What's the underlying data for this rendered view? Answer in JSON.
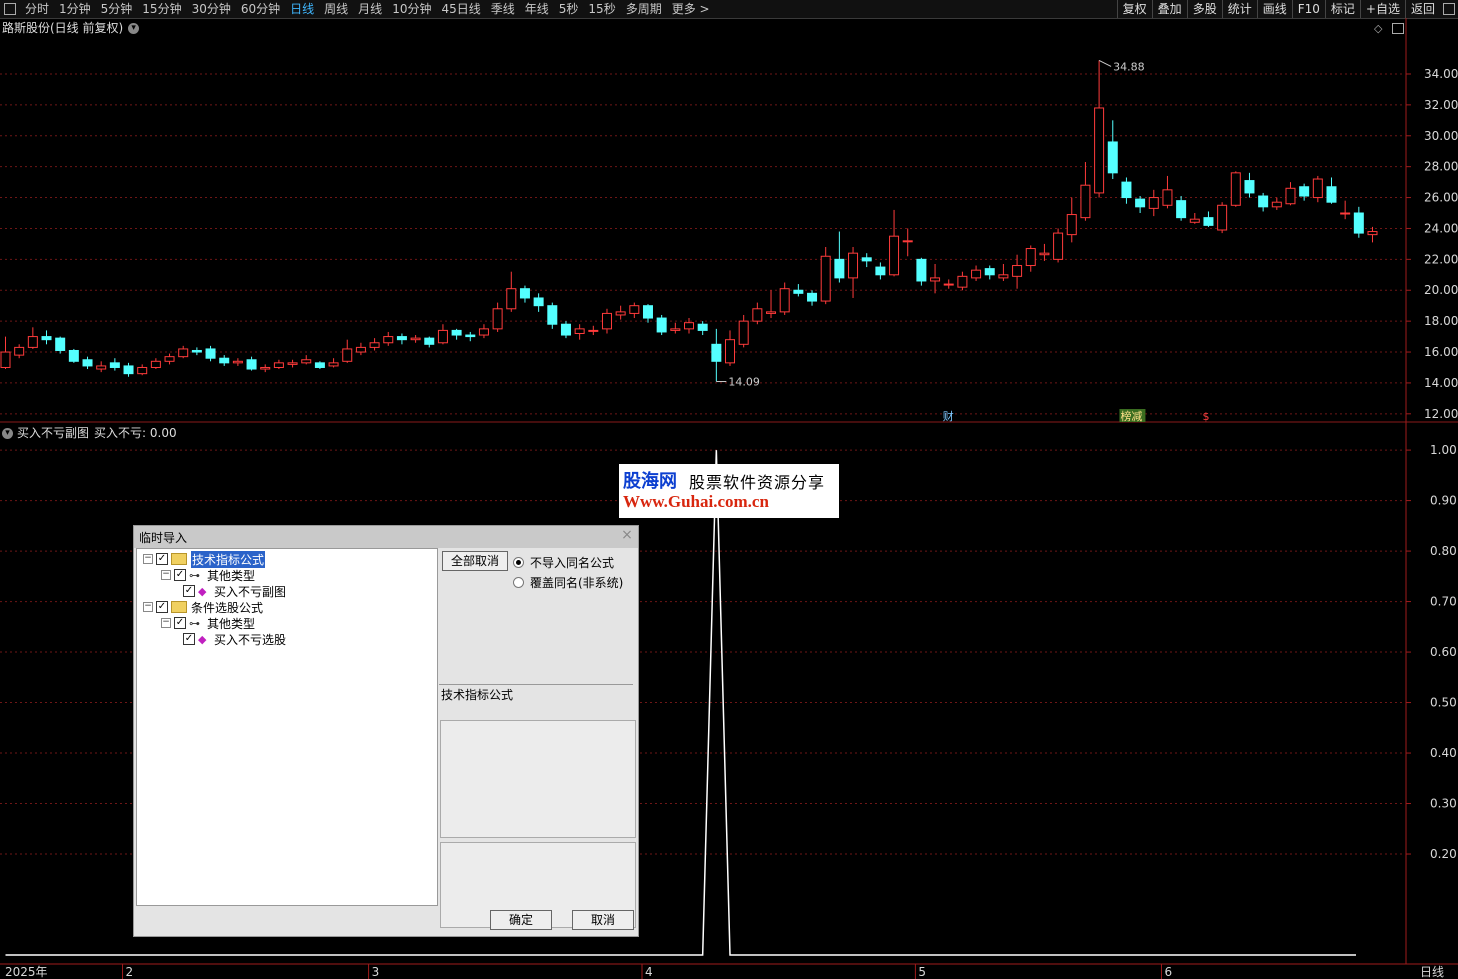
{
  "topbar": {
    "periods": [
      "分时",
      "1分钟",
      "5分钟",
      "15分钟",
      "30分钟",
      "60分钟",
      "日线",
      "周线",
      "月线",
      "10分钟",
      "45日线",
      "季线",
      "年线",
      "5秒",
      "15秒",
      "多周期",
      "更多 >"
    ],
    "active_period": "日线",
    "right_buttons": [
      "复权",
      "叠加",
      "多股",
      "统计",
      "画线",
      "F10",
      "标记",
      "+自选",
      "返回"
    ]
  },
  "main_chart": {
    "title": "路斯股份(日线 前复权)"
  },
  "sub_chart": {
    "title": "买入不亏副图",
    "value_label": "买入不亏: 0.00"
  },
  "watermark": {
    "brand": "股海网",
    "tagline": "股票软件资源分享",
    "url": "Www.Guhai.com.cn"
  },
  "dialog": {
    "title": "临时导入",
    "tree": [
      {
        "label": "技术指标公式",
        "level": 0,
        "selected": true
      },
      {
        "label": "其他类型",
        "level": 1
      },
      {
        "label": "买入不亏副图",
        "level": 2
      },
      {
        "label": "条件选股公式",
        "level": 0
      },
      {
        "label": "其他类型",
        "level": 1
      },
      {
        "label": "买入不亏选股",
        "level": 2
      }
    ],
    "cancel_all": "全部取消",
    "radio_no_import": "不导入同名公式",
    "radio_overwrite": "覆盖同名(非系统)",
    "group_label": "技术指标公式",
    "ok": "确定",
    "cancel": "取消"
  },
  "chart_data": [
    {
      "type": "candlestick",
      "title": "路斯股份(日线 前复权)",
      "y_ticks": [
        "34.00",
        "32.00",
        "30.00",
        "28.00",
        "26.00",
        "24.00",
        "22.00",
        "20.00",
        "18.00",
        "16.00",
        "14.00",
        "12.00"
      ],
      "ylim": [
        11.6,
        36.2
      ],
      "annotations": {
        "high": "34.88",
        "low": "14.09"
      },
      "markers": [
        "财",
        "榜减",
        "$"
      ],
      "x_labels": [
        "2025年",
        "2",
        "3",
        "4",
        "5",
        "6"
      ],
      "x_label_days": [
        0,
        9,
        27,
        47,
        67,
        85
      ],
      "up_color": "#ff3b3b",
      "down_color": "#54ffff",
      "candles": [
        [
          15.0,
          16.0,
          17.0,
          14.9
        ],
        [
          15.8,
          16.3,
          16.5,
          15.6
        ],
        [
          16.3,
          17.0,
          17.6,
          16.2
        ],
        [
          17.0,
          16.8,
          17.4,
          16.5
        ],
        [
          16.9,
          16.1,
          17.0,
          15.9
        ],
        [
          16.1,
          15.4,
          16.2,
          15.3
        ],
        [
          15.5,
          15.1,
          15.7,
          14.9
        ],
        [
          14.9,
          15.1,
          15.4,
          14.7
        ],
        [
          15.3,
          15.0,
          15.6,
          14.8
        ],
        [
          15.1,
          14.6,
          15.3,
          14.4
        ],
        [
          14.6,
          15.0,
          15.2,
          14.5
        ],
        [
          15.0,
          15.4,
          15.6,
          14.9
        ],
        [
          15.4,
          15.7,
          15.9,
          15.2
        ],
        [
          15.7,
          16.2,
          16.4,
          15.6
        ],
        [
          16.1,
          16.0,
          16.3,
          15.8
        ],
        [
          16.2,
          15.6,
          16.4,
          15.4
        ],
        [
          15.6,
          15.3,
          15.8,
          15.1
        ],
        [
          15.3,
          15.4,
          15.6,
          15.1
        ],
        [
          15.5,
          14.9,
          15.7,
          14.8
        ],
        [
          14.9,
          15.0,
          15.2,
          14.7
        ],
        [
          15.0,
          15.3,
          15.5,
          14.9
        ],
        [
          15.2,
          15.3,
          15.5,
          15.0
        ],
        [
          15.3,
          15.5,
          15.8,
          15.2
        ],
        [
          15.3,
          15.0,
          15.4,
          14.9
        ],
        [
          15.1,
          15.3,
          15.6,
          15.0
        ],
        [
          15.4,
          16.2,
          16.8,
          15.3
        ],
        [
          16.0,
          16.3,
          16.6,
          15.8
        ],
        [
          16.3,
          16.6,
          16.9,
          16.1
        ],
        [
          16.6,
          17.0,
          17.3,
          16.4
        ],
        [
          17.0,
          16.8,
          17.2,
          16.5
        ],
        [
          16.8,
          16.9,
          17.1,
          16.6
        ],
        [
          16.9,
          16.5,
          17.0,
          16.3
        ],
        [
          16.6,
          17.4,
          17.8,
          16.5
        ],
        [
          17.4,
          17.1,
          17.5,
          16.8
        ],
        [
          17.1,
          17.0,
          17.3,
          16.7
        ],
        [
          17.1,
          17.5,
          17.8,
          16.9
        ],
        [
          17.5,
          18.8,
          19.2,
          17.3
        ],
        [
          18.8,
          20.1,
          21.2,
          18.6
        ],
        [
          20.1,
          19.5,
          20.3,
          19.2
        ],
        [
          19.5,
          19.0,
          19.8,
          18.6
        ],
        [
          19.0,
          17.8,
          19.2,
          17.5
        ],
        [
          17.8,
          17.1,
          18.0,
          16.9
        ],
        [
          17.2,
          17.5,
          17.8,
          16.8
        ],
        [
          17.4,
          17.4,
          17.7,
          17.1
        ],
        [
          17.5,
          18.5,
          18.8,
          17.2
        ],
        [
          18.4,
          18.6,
          19.0,
          18.1
        ],
        [
          18.5,
          19.0,
          19.2,
          18.2
        ],
        [
          19.0,
          18.2,
          19.1,
          17.9
        ],
        [
          18.2,
          17.3,
          18.4,
          17.1
        ],
        [
          17.4,
          17.5,
          17.9,
          17.2
        ],
        [
          17.5,
          17.9,
          18.2,
          17.2
        ],
        [
          17.8,
          17.4,
          18.0,
          17.1
        ],
        [
          16.5,
          15.4,
          17.5,
          14.09
        ],
        [
          15.3,
          16.8,
          17.4,
          15.1
        ],
        [
          16.5,
          18.0,
          18.4,
          16.3
        ],
        [
          18.0,
          18.8,
          19.2,
          17.8
        ],
        [
          18.5,
          18.6,
          20.0,
          18.2
        ],
        [
          18.6,
          20.1,
          20.5,
          18.4
        ],
        [
          20.0,
          19.8,
          20.4,
          19.6
        ],
        [
          19.8,
          19.3,
          20.0,
          19.0
        ],
        [
          19.3,
          22.2,
          22.8,
          19.1
        ],
        [
          22.0,
          20.8,
          23.8,
          20.5
        ],
        [
          20.8,
          22.4,
          22.8,
          19.5
        ],
        [
          22.1,
          21.9,
          22.4,
          21.5
        ],
        [
          21.5,
          21.0,
          21.8,
          20.7
        ],
        [
          21.0,
          23.5,
          25.2,
          20.9
        ],
        [
          23.2,
          23.2,
          24.0,
          22.2
        ],
        [
          22.0,
          20.6,
          22.1,
          20.3
        ],
        [
          20.6,
          20.8,
          21.7,
          19.8
        ],
        [
          20.4,
          20.4,
          20.7,
          20.1
        ],
        [
          20.2,
          20.9,
          21.2,
          20.0
        ],
        [
          20.8,
          21.3,
          21.6,
          20.6
        ],
        [
          21.4,
          21.0,
          21.6,
          20.7
        ],
        [
          20.8,
          21.0,
          21.7,
          20.6
        ],
        [
          20.9,
          21.6,
          22.3,
          20.1
        ],
        [
          21.6,
          22.7,
          22.9,
          21.2
        ],
        [
          22.3,
          22.4,
          23.0,
          21.9
        ],
        [
          22.0,
          23.7,
          24.0,
          21.8
        ],
        [
          23.6,
          24.9,
          26.0,
          23.1
        ],
        [
          24.7,
          26.8,
          28.3,
          24.5
        ],
        [
          26.3,
          31.8,
          34.88,
          26.0
        ],
        [
          29.6,
          27.6,
          31.0,
          27.2
        ],
        [
          27.0,
          26.0,
          27.3,
          25.6
        ],
        [
          25.9,
          25.4,
          26.1,
          25.0
        ],
        [
          25.3,
          26.0,
          26.5,
          24.8
        ],
        [
          25.5,
          26.5,
          27.4,
          25.3
        ],
        [
          25.8,
          24.7,
          26.1,
          24.5
        ],
        [
          24.4,
          24.6,
          25.0,
          24.3
        ],
        [
          24.7,
          24.2,
          25.1,
          24.1
        ],
        [
          23.9,
          25.5,
          25.7,
          23.7
        ],
        [
          25.5,
          27.6,
          27.7,
          25.4
        ],
        [
          27.1,
          26.3,
          27.6,
          26.0
        ],
        [
          26.1,
          25.4,
          26.3,
          25.1
        ],
        [
          25.4,
          25.7,
          26.0,
          25.2
        ],
        [
          25.6,
          26.6,
          27.0,
          25.5
        ],
        [
          26.7,
          26.1,
          26.9,
          25.8
        ],
        [
          26.0,
          27.2,
          27.4,
          25.7
        ],
        [
          26.7,
          25.7,
          27.3,
          25.6
        ],
        [
          25.0,
          25.0,
          25.8,
          24.6
        ],
        [
          25.0,
          23.7,
          25.4,
          23.4
        ],
        [
          23.6,
          23.8,
          24.1,
          23.1
        ]
      ]
    },
    {
      "type": "line",
      "title": "买入不亏副图",
      "y_ticks": [
        "1.00",
        "0.90",
        "0.80",
        "0.70",
        "0.60",
        "0.50",
        "0.40",
        "0.30",
        "0.20"
      ],
      "ylim": [
        0,
        1.02
      ],
      "series": [
        {
          "name": "买入不亏",
          "spike_day": 52,
          "values_note_free": true
        }
      ],
      "x": [
        0,
        51,
        52,
        53,
        101
      ],
      "values": [
        0,
        0,
        1,
        0,
        0
      ]
    }
  ]
}
